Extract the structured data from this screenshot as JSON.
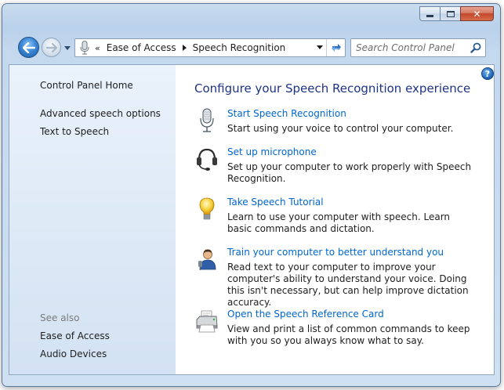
{
  "window": {
    "caption_buttons": {
      "minimize_icon": "minimize-icon",
      "maximize_icon": "maximize-icon",
      "close_icon": "close-icon",
      "close_glyph": "✕"
    }
  },
  "toolbar": {
    "back_icon": "back-arrow-icon",
    "forward_icon": "forward-arrow-icon",
    "address": {
      "icon": "microphone-icon",
      "overflow": "«",
      "breadcrumbs": [
        "Ease of Access",
        "Speech Recognition"
      ]
    },
    "search": {
      "placeholder": "Search Control Panel",
      "value": ""
    }
  },
  "sidebar": {
    "home_label": "Control Panel Home",
    "links": [
      "Advanced speech options",
      "Text to Speech"
    ],
    "see_also_label": "See also",
    "see_also": [
      "Ease of Access",
      "Audio Devices"
    ]
  },
  "main": {
    "title": "Configure your Speech Recognition experience",
    "help_glyph": "?",
    "tasks": [
      {
        "link": "Start Speech Recognition",
        "desc": "Start using your voice to control your computer.",
        "icon": "microphone-icon"
      },
      {
        "link": "Set up microphone",
        "desc": "Set up your computer to work properly with Speech Recognition.",
        "icon": "headset-icon"
      },
      {
        "link": "Take Speech Tutorial",
        "desc": "Learn to use your computer with speech.  Learn basic commands and dictation.",
        "icon": "lightbulb-icon"
      },
      {
        "link": "Train your computer to better understand you",
        "desc": "Read text to your computer to improve your computer's ability to understand your voice.  Doing this isn't necessary, but can help improve dictation accuracy.",
        "icon": "user-training-icon"
      },
      {
        "link": "Open the Speech Reference Card",
        "desc": "View and print a list of common commands to keep with you so you always know what to say.",
        "icon": "printer-icon"
      }
    ]
  },
  "colors": {
    "link": "#0066cc",
    "title": "#1e3287",
    "sidebar_bg": "#dde9f6",
    "frame": "#b9d1ea"
  }
}
